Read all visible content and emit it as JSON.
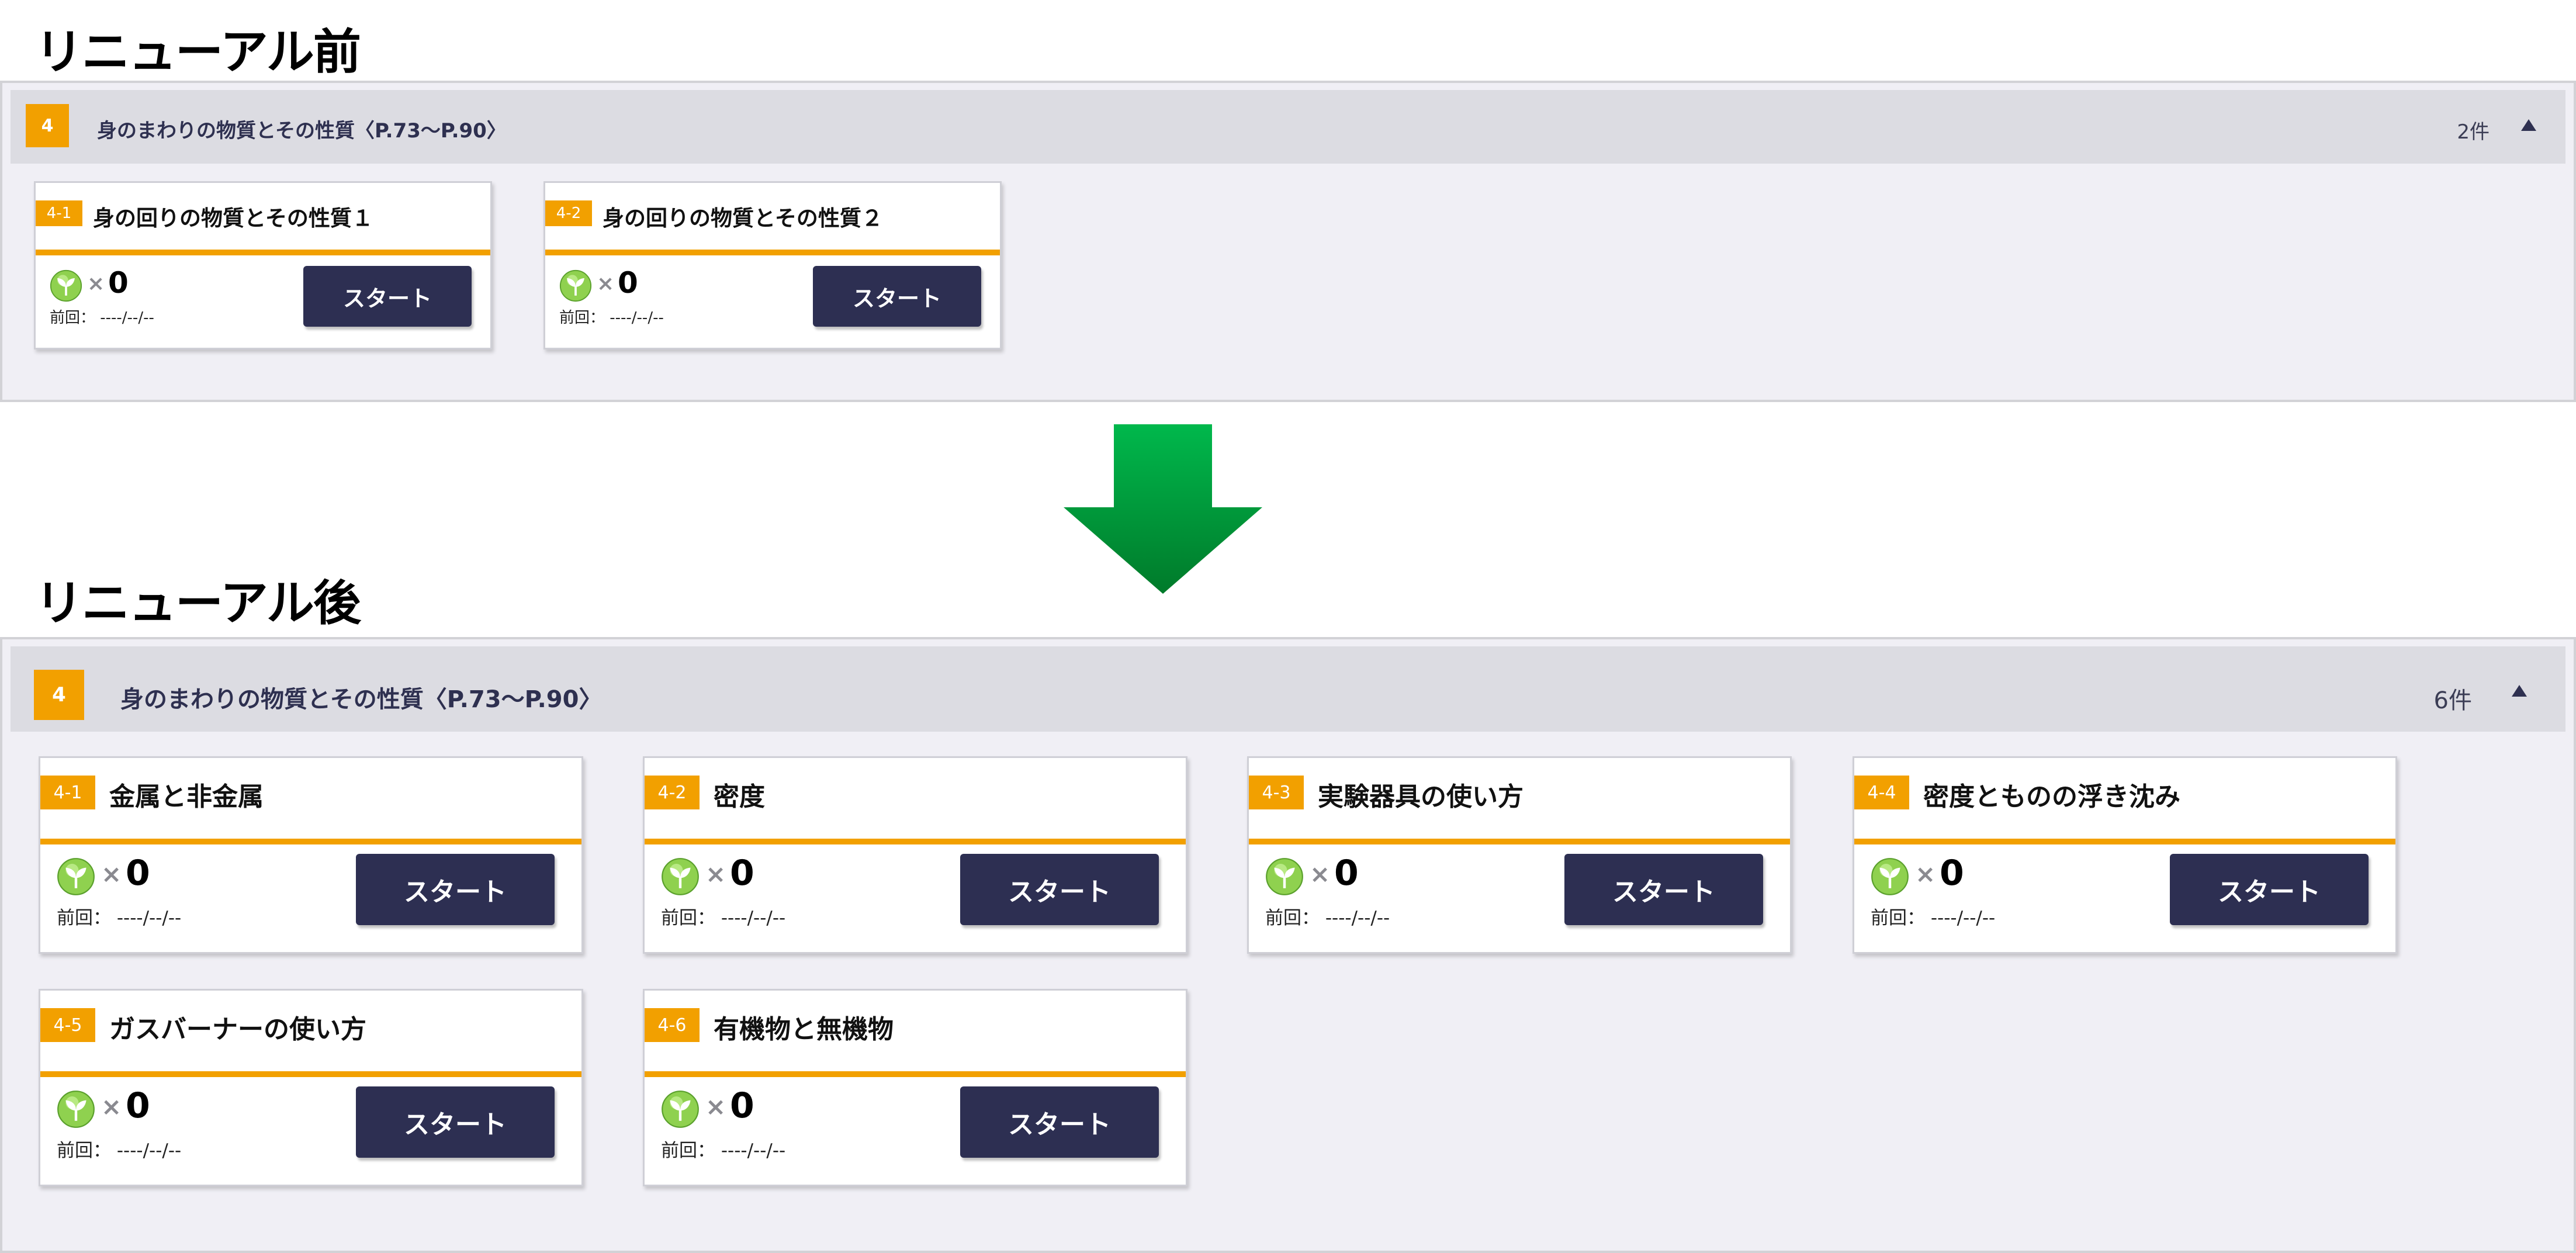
{
  "headings": {
    "before": "リニューアル前",
    "after": "リニューアル後"
  },
  "before": {
    "unit_number": "4",
    "unit_title": "身のまわりの物質とその性質〈P.73〜P.90〉",
    "count": "2件",
    "cards": [
      {
        "badge": "4-1",
        "title": "身の回りの物質とその性質１",
        "times": "×",
        "count": "0",
        "last": "前回： ----/--/--",
        "start": "スタート"
      },
      {
        "badge": "4-2",
        "title": "身の回りの物質とその性質２",
        "times": "×",
        "count": "0",
        "last": "前回： ----/--/--",
        "start": "スタート"
      }
    ]
  },
  "after": {
    "unit_number": "4",
    "unit_title": "身のまわりの物質とその性質〈P.73〜P.90〉",
    "count": "6件",
    "cards": [
      {
        "badge": "4-1",
        "title": "金属と非金属",
        "times": "×",
        "count": "0",
        "last": "前回： ----/--/--",
        "start": "スタート"
      },
      {
        "badge": "4-2",
        "title": "密度",
        "times": "×",
        "count": "0",
        "last": "前回： ----/--/--",
        "start": "スタート"
      },
      {
        "badge": "4-3",
        "title": "実験器具の使い方",
        "times": "×",
        "count": "0",
        "last": "前回： ----/--/--",
        "start": "スタート"
      },
      {
        "badge": "4-4",
        "title": "密度とものの浮き沈み",
        "times": "×",
        "count": "0",
        "last": "前回： ----/--/--",
        "start": "スタート"
      },
      {
        "badge": "4-5",
        "title": "ガスバーナーの使い方",
        "times": "×",
        "count": "0",
        "last": "前回： ----/--/--",
        "start": "スタート"
      },
      {
        "badge": "4-6",
        "title": "有機物と無機物",
        "times": "×",
        "count": "0",
        "last": "前回： ----/--/--",
        "start": "スタート"
      }
    ]
  },
  "colors": {
    "accent_orange": "#f2a000",
    "button_navy": "#2d2f52",
    "arrow_green": "#00a040",
    "panel_bg": "#f0eff5"
  },
  "icons": {
    "sprout": "sprout-icon",
    "collapse": "triangle-up-icon",
    "transition": "down-arrow-icon"
  }
}
